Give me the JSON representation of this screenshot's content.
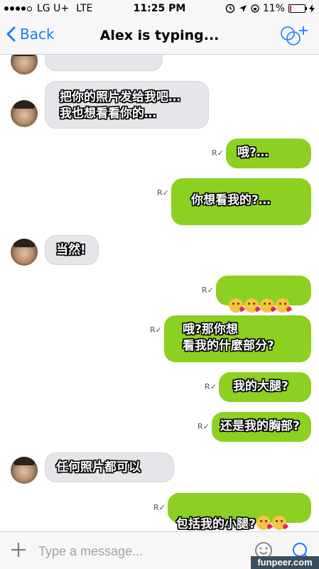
{
  "status_bar": {
    "carrier": "LG U+",
    "network": "LTE",
    "time": "11:25 PM",
    "battery": "11%"
  },
  "nav": {
    "back_label": "Back",
    "title": "Alex is typing..."
  },
  "messages": [
    {
      "dir": "in",
      "text": "把你的照片发给我吧…\n我也想看看你的…"
    },
    {
      "dir": "out",
      "text": "哦?…"
    },
    {
      "dir": "out",
      "text": "你想看我的?…"
    },
    {
      "dir": "in",
      "text": "当然!"
    },
    {
      "dir": "out",
      "text": ""
    },
    {
      "dir": "out",
      "text": "哦?那你想\n看我的什麼部分?"
    },
    {
      "dir": "out",
      "text": "我的大腿?"
    },
    {
      "dir": "out",
      "text": "还是我的胸部?"
    },
    {
      "dir": "in",
      "text": "任何照片都可以"
    },
    {
      "dir": "out",
      "text": "包括我的小腿?"
    }
  ],
  "read_receipt": "R✓",
  "input": {
    "placeholder": "Type a message..."
  },
  "watermark": "funpeer.com",
  "colors": {
    "accent": "#1a7cf6",
    "outgoing_bubble": "#8cd021",
    "incoming_bubble": "#e5e5ea",
    "battery_low": "#e0302b"
  },
  "icons": [
    "back-chevron-icon",
    "group-add-icon",
    "location-arrow-icon",
    "alarm-icon",
    "battery-icon",
    "plus-icon",
    "smiley-icon",
    "search-icon",
    "kiss-emoji-icon"
  ]
}
